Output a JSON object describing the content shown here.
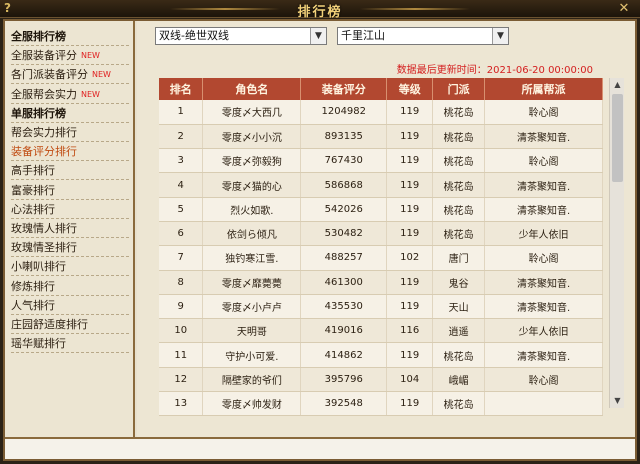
{
  "window": {
    "title": "排行榜",
    "help": "?",
    "close": "✕"
  },
  "sidebar": {
    "items": [
      {
        "label": "全服排行榜",
        "new": "",
        "type": "header"
      },
      {
        "label": "全服装备评分",
        "new": "NEW",
        "type": "item"
      },
      {
        "label": "各门派装备评分",
        "new": "NEW",
        "type": "item"
      },
      {
        "label": "全服帮会实力",
        "new": "NEW",
        "type": "item"
      },
      {
        "label": "单服排行榜",
        "new": "",
        "type": "header"
      },
      {
        "label": "帮会实力排行",
        "new": "",
        "type": "item"
      },
      {
        "label": "装备评分排行",
        "new": "",
        "type": "active"
      },
      {
        "label": "高手排行",
        "new": "",
        "type": "item"
      },
      {
        "label": "富豪排行",
        "new": "",
        "type": "item"
      },
      {
        "label": "心法排行",
        "new": "",
        "type": "item"
      },
      {
        "label": "玫瑰情人排行",
        "new": "",
        "type": "item"
      },
      {
        "label": "玫瑰情圣排行",
        "new": "",
        "type": "item"
      },
      {
        "label": "小喇叭排行",
        "new": "",
        "type": "item"
      },
      {
        "label": "修炼排行",
        "new": "",
        "type": "item"
      },
      {
        "label": "人气排行",
        "new": "",
        "type": "item"
      },
      {
        "label": "庄园舒适度排行",
        "new": "",
        "type": "item"
      },
      {
        "label": "瑶华赋排行",
        "new": "",
        "type": "item"
      }
    ]
  },
  "filters": {
    "server_group": "双线-绝世双线",
    "server": "千里江山"
  },
  "update_time": "数据最后更新时间：2021-06-20 00:00:00",
  "table": {
    "headers": [
      "排名",
      "角色名",
      "装备评分",
      "等级",
      "门派",
      "所属帮派"
    ],
    "rows": [
      [
        "1",
        "零度〆大西几",
        "1204982",
        "119",
        "桃花岛",
        "聆心阁"
      ],
      [
        "2",
        "零度〆小小沉",
        "893135",
        "119",
        "桃花岛",
        "清茶聚知音."
      ],
      [
        "3",
        "零度〆弥毅狗",
        "767430",
        "119",
        "桃花岛",
        "聆心阁"
      ],
      [
        "4",
        "零度〆猫的心",
        "586868",
        "119",
        "桃花岛",
        "清茶聚知音."
      ],
      [
        "5",
        "烈火如歌.",
        "542026",
        "119",
        "桃花岛",
        "清茶聚知音."
      ],
      [
        "6",
        "依剑ら倾凡",
        "530482",
        "119",
        "桃花岛",
        "少年人依旧"
      ],
      [
        "7",
        "独钓寒江雪.",
        "488257",
        "102",
        "唐门",
        "聆心阁"
      ],
      [
        "8",
        "零度〆靡薨薨",
        "461300",
        "119",
        "鬼谷",
        "清茶聚知音."
      ],
      [
        "9",
        "零度〆小卢卢",
        "435530",
        "119",
        "天山",
        "清茶聚知音."
      ],
      [
        "10",
        "天明哥",
        "419016",
        "116",
        "逍遥",
        "少年人依旧"
      ],
      [
        "11",
        "守护小可爱.",
        "414862",
        "119",
        "桃花岛",
        "清茶聚知音."
      ],
      [
        "12",
        "隔壁家的爷们",
        "395796",
        "104",
        "峨嵋",
        "聆心阁"
      ],
      [
        "13",
        "零度〆帅发财",
        "392548",
        "119",
        "桃花岛",
        ""
      ]
    ]
  },
  "colors": {
    "header_bg": "#b24830",
    "accent_red": "#d42020",
    "active_item": "#c04a10"
  }
}
